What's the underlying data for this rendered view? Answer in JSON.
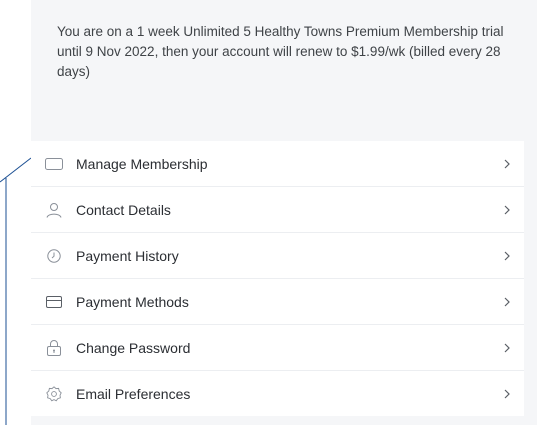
{
  "notice": {
    "text": "You are on a 1 week Unlimited 5 Healthy Towns Premium Membership trial until 9 Nov 2022, then your account will renew to $1.99/wk (billed every 28 days)"
  },
  "menu": {
    "items": [
      {
        "label": "Manage Membership",
        "icon": "membership-card-icon"
      },
      {
        "label": "Contact Details",
        "icon": "person-icon"
      },
      {
        "label": "Payment History",
        "icon": "clock-icon"
      },
      {
        "label": "Payment Methods",
        "icon": "credit-card-icon"
      },
      {
        "label": "Change Password",
        "icon": "lock-icon"
      },
      {
        "label": "Email Preferences",
        "icon": "settings-icon"
      }
    ],
    "chevron": ">"
  },
  "colors": {
    "panel_bg": "#f5f6f8",
    "text": "#2b2e33",
    "icon": "#8a9099",
    "accent_line": "#1b4f93"
  }
}
